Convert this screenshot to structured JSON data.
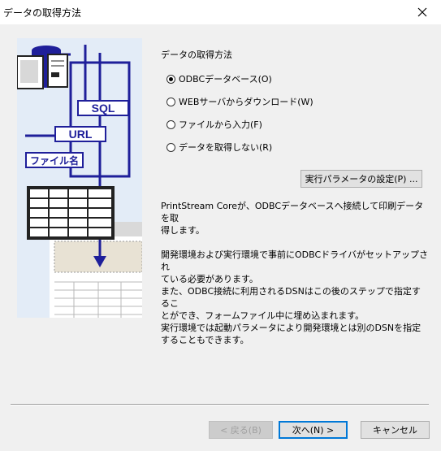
{
  "window": {
    "title": "データの取得方法"
  },
  "illustration": {
    "labels": {
      "sql": "SQL",
      "url": "URL",
      "file": "ファイル名"
    }
  },
  "section_label": "データの取得方法",
  "options": [
    {
      "label": "ODBCデータベース(O)",
      "selected": true
    },
    {
      "label": "WEBサーバからダウンロード(W)",
      "selected": false
    },
    {
      "label": "ファイルから入力(F)",
      "selected": false
    },
    {
      "label": "データを取得しない(R)",
      "selected": false
    }
  ],
  "param_button": "実行パラメータの設定(P) ...",
  "description": [
    "PrintStream Coreが、ODBCデータベースへ接続して印刷データを取",
    "得します。",
    "",
    "開発環境および実行環境で事前にODBCドライバがセットアップされ",
    "ている必要があります。",
    "また、ODBC接続に利用されるDSNはこの後のステップで指定するこ",
    "とができ、フォームファイル中に埋め込まれます。",
    "実行環境では起動パラメータにより開発環境とは別のDSNを指定",
    "することもできます。"
  ],
  "footer": {
    "back": "< 戻る(B)",
    "next": "次へ(N) >",
    "cancel": "キャンセル"
  },
  "colors": {
    "accent": "#0078d7",
    "illustration_blue": "#1f1f9a",
    "illustration_bg": "#e3ecf7"
  }
}
